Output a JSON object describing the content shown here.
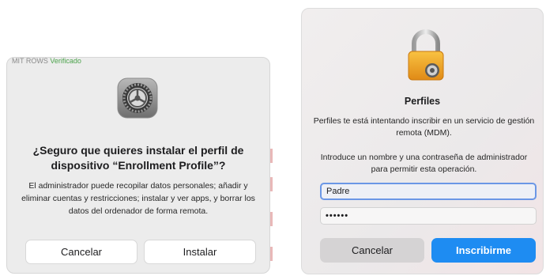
{
  "left_dialog": {
    "residue_text": "MIT ROWS",
    "residue_green": "Verificado",
    "title": "¿Seguro que quieres instalar el perfil de dispositivo “Enrollment Profile”?",
    "body": "El administrador puede recopilar datos personales; añadir y eliminar cuentas y restricciones; instalar y ver apps, y borrar los datos del ordenador de forma remota.",
    "cancel_label": "Cancelar",
    "install_label": "Instalar",
    "icon": "system-settings-icon"
  },
  "right_dialog": {
    "icon": "lock-profile-icon",
    "title": "Perfiles",
    "body": "Perfiles te está intentando inscribir en un servicio de gestión remota (MDM).",
    "instructions": "Introduce un nombre y una contraseña de administrador para permitir esta operación.",
    "username_value": "Padre",
    "password_value": "••••••",
    "cancel_label": "Cancelar",
    "enroll_label": "Inscribirme"
  },
  "colors": {
    "accent_blue": "#1e8cf2",
    "focus_ring": "#6b97e6",
    "dialog_bg": "#ececec"
  }
}
